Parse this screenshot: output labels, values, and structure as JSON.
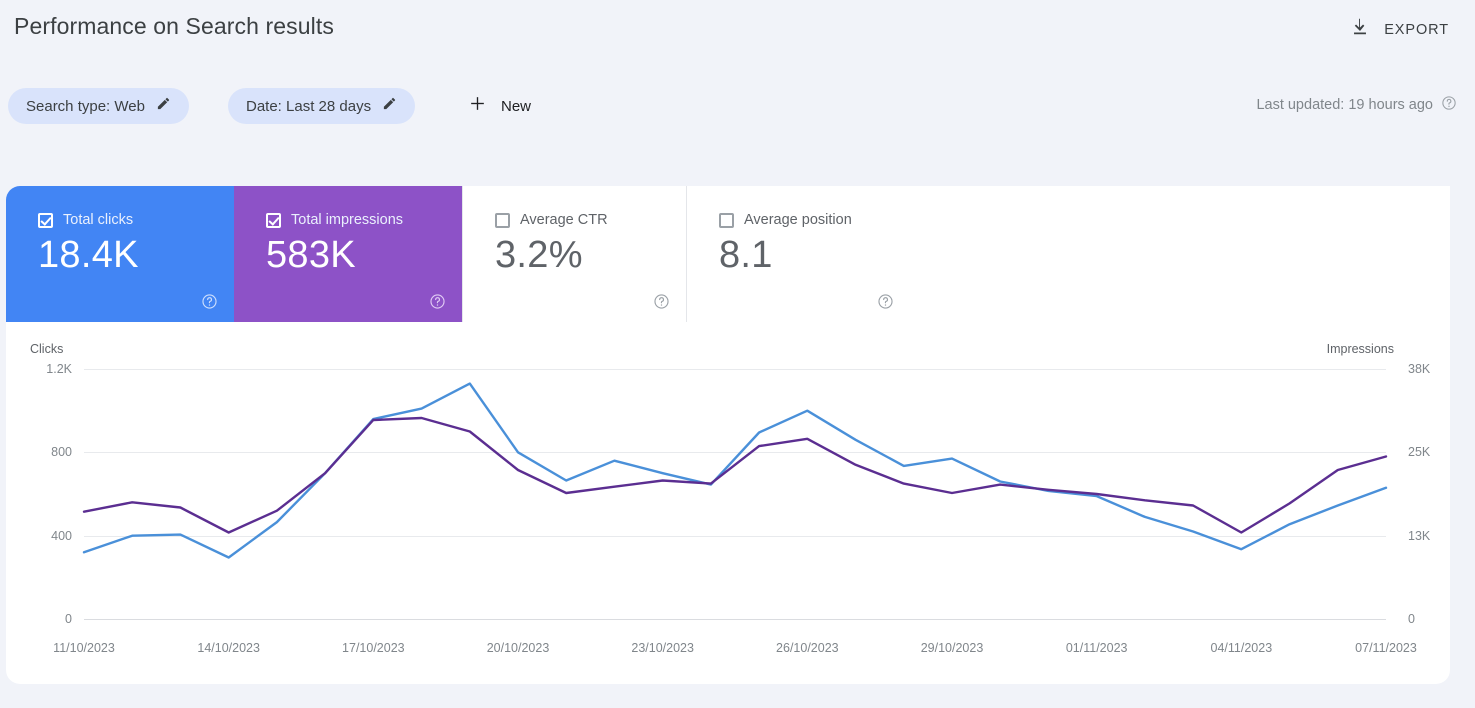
{
  "header": {
    "title": "Performance on Search results",
    "export_label": "EXPORT",
    "export_icon": "download-icon"
  },
  "filters": {
    "chips": [
      {
        "label": "Search type: Web",
        "edit_icon": "pencil-icon"
      },
      {
        "label": "Date: Last 28 days",
        "edit_icon": "pencil-icon"
      }
    ],
    "new_label": "New",
    "new_icon": "plus-icon",
    "last_updated": "Last updated: 19 hours ago",
    "last_updated_icon": "help-circle-icon"
  },
  "metrics": [
    {
      "label": "Total clicks",
      "value": "18.4K",
      "checked": true,
      "color": "#4285f4",
      "help_icon": "help-circle-icon"
    },
    {
      "label": "Total impressions",
      "value": "583K",
      "checked": true,
      "color": "#8d52c7",
      "help_icon": "help-circle-icon"
    },
    {
      "label": "Average CTR",
      "value": "3.2%",
      "checked": false,
      "color": "#ffffff",
      "help_icon": "help-circle-icon"
    },
    {
      "label": "Average position",
      "value": "8.1",
      "checked": false,
      "color": "#ffffff",
      "help_icon": "help-circle-icon"
    }
  ],
  "chart_data": {
    "type": "line",
    "title": "",
    "left_axis_label": "Clicks",
    "right_axis_label": "Impressions",
    "left_ticks": [
      "1.2K",
      "800",
      "400",
      "0"
    ],
    "left_tick_values": [
      1200,
      800,
      400,
      0
    ],
    "right_ticks": [
      "38K",
      "25K",
      "13K",
      "0"
    ],
    "right_tick_values": [
      38000,
      25000,
      13000,
      0
    ],
    "ylim_left": [
      0,
      1200
    ],
    "ylim_right": [
      0,
      38000
    ],
    "grid": true,
    "legend": "metric-cards",
    "x": [
      "11/10/2023",
      "12/10/2023",
      "13/10/2023",
      "14/10/2023",
      "15/10/2023",
      "16/10/2023",
      "17/10/2023",
      "18/10/2023",
      "19/10/2023",
      "20/10/2023",
      "21/10/2023",
      "22/10/2023",
      "23/10/2023",
      "24/10/2023",
      "25/10/2023",
      "26/10/2023",
      "27/10/2023",
      "28/10/2023",
      "29/10/2023",
      "30/10/2023",
      "31/10/2023",
      "01/11/2023",
      "02/11/2023",
      "03/11/2023",
      "04/11/2023",
      "05/11/2023",
      "06/11/2023",
      "07/11/2023"
    ],
    "xtick_labels": [
      "11/10/2023",
      "14/10/2023",
      "17/10/2023",
      "20/10/2023",
      "23/10/2023",
      "26/10/2023",
      "29/10/2023",
      "01/11/2023",
      "04/11/2023",
      "07/11/2023"
    ],
    "xtick_indices": [
      0,
      3,
      6,
      9,
      12,
      15,
      18,
      21,
      24,
      27
    ],
    "series": [
      {
        "name": "Clicks",
        "color": "#4a90d9",
        "axis": "left",
        "values": [
          320,
          400,
          405,
          295,
          465,
          700,
          960,
          1010,
          1130,
          800,
          665,
          760,
          700,
          645,
          895,
          1000,
          860,
          735,
          770,
          660,
          615,
          590,
          490,
          420,
          335,
          455,
          545,
          630
        ]
      },
      {
        "name": "Impressions",
        "color": "#5b2e91",
        "axis": "right",
        "values": [
          515,
          560,
          535,
          415,
          520,
          700,
          955,
          965,
          900,
          715,
          605,
          635,
          665,
          650,
          830,
          865,
          740,
          650,
          605,
          645,
          620,
          600,
          570,
          545,
          415,
          555,
          715,
          780
        ]
      }
    ]
  }
}
